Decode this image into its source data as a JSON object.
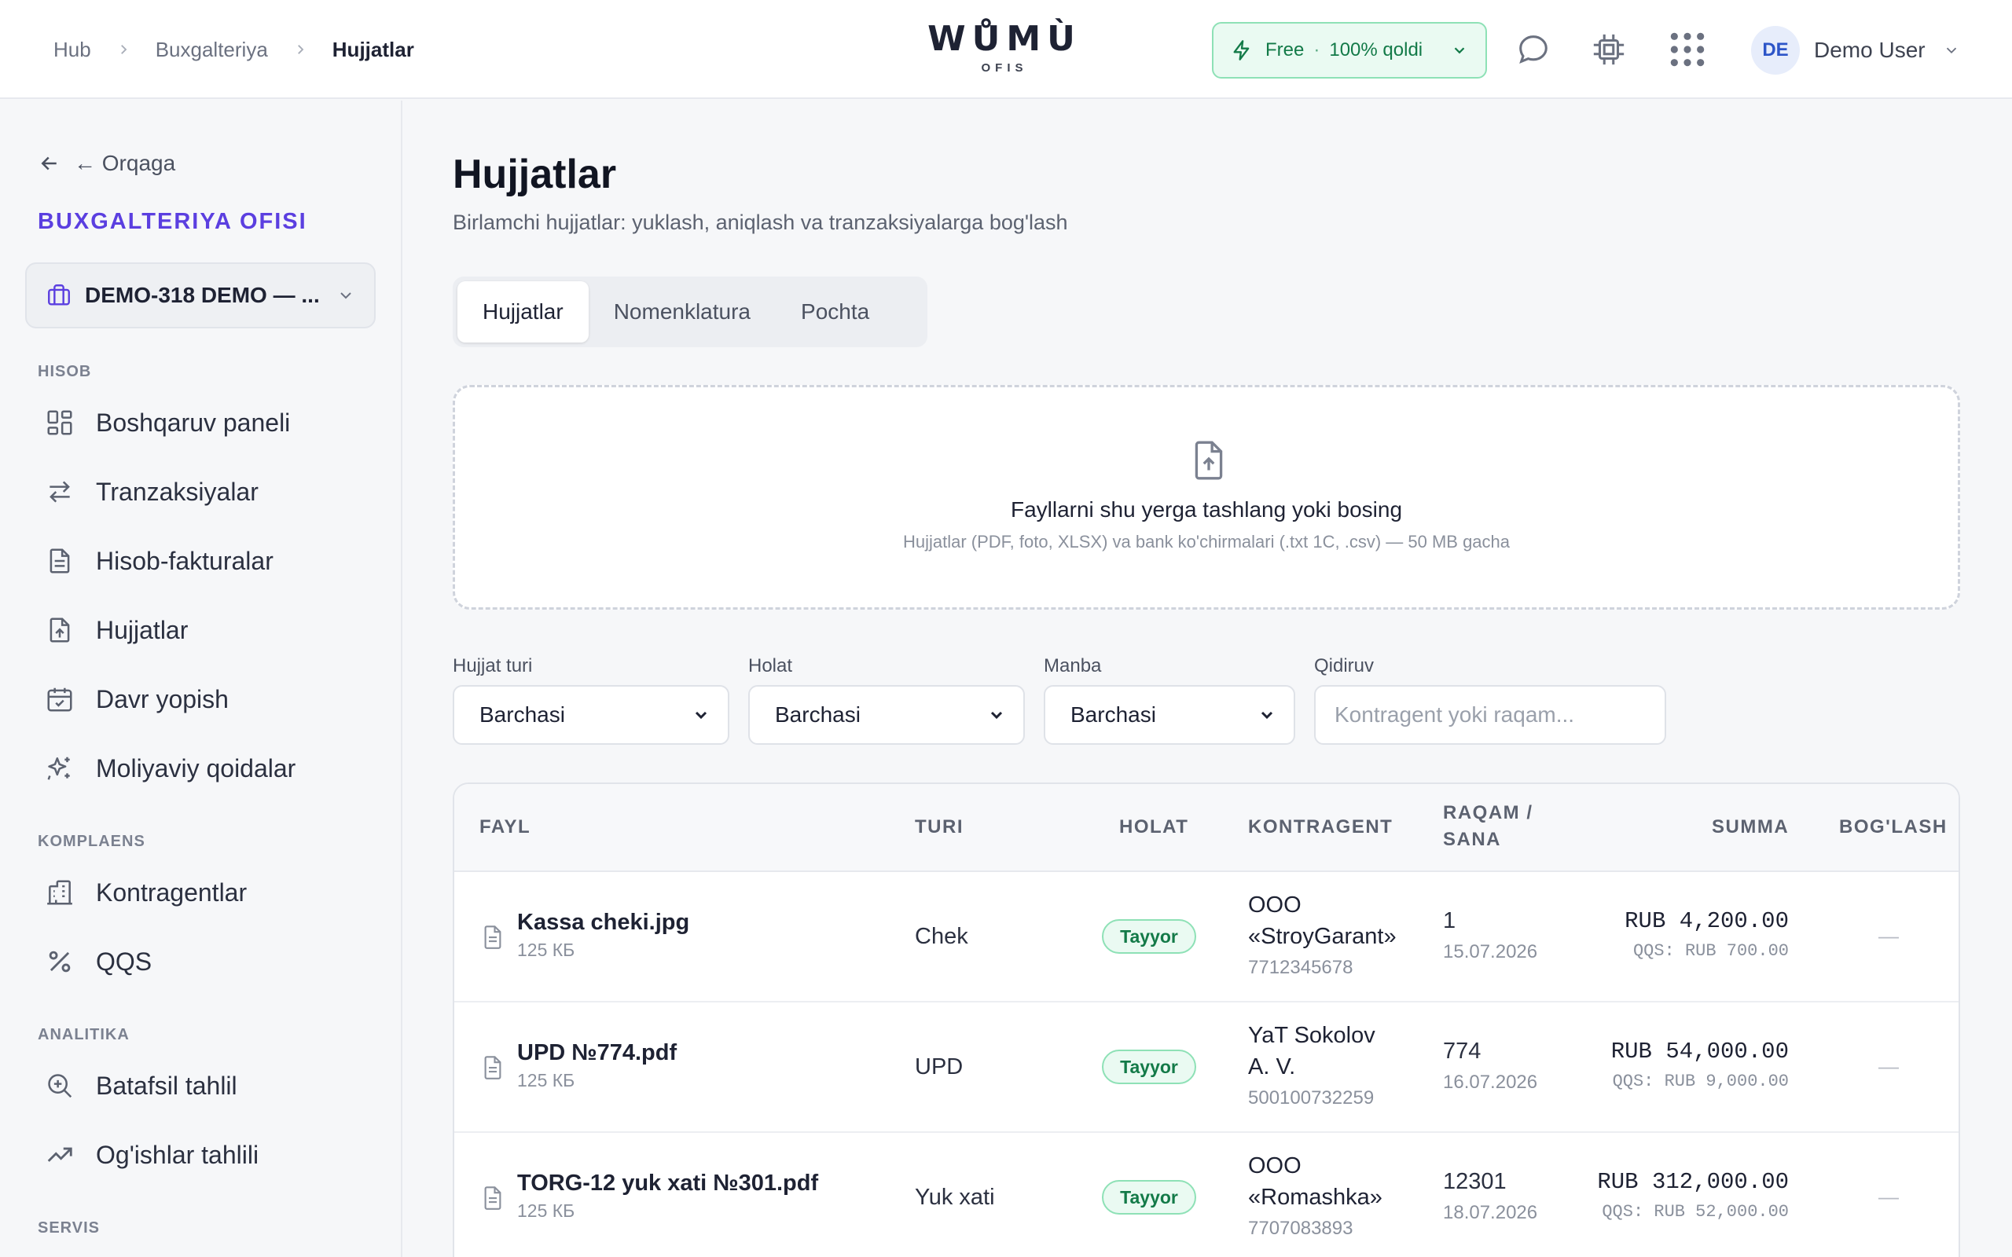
{
  "breadcrumb": [
    "Hub",
    "Buxgalteriya",
    "Hujjatlar"
  ],
  "logo": {
    "name": "WŮMÙ",
    "sub": "OFIS"
  },
  "plan": {
    "name": "Free",
    "status": "100% qoldi"
  },
  "user": {
    "initials": "DE",
    "name": "Demo User"
  },
  "sidebar": {
    "back_label": "← Orqaga",
    "office_title": "BUXGALTERIYA OFISI",
    "org_label": "DEMO-318 DEMO — ...",
    "sections": {
      "hisob": "HISOB",
      "komplaens": "KOMPLAENS",
      "analitika": "ANALITIKA",
      "servis": "SERVIS"
    },
    "items": {
      "dashboard": "Boshqaruv paneli",
      "transactions": "Tranzaksiyalar",
      "invoices": "Hisob-fakturalar",
      "documents": "Hujjatlar",
      "period_close": "Davr yopish",
      "rules": "Moliyaviy qoidalar",
      "counterparties": "Kontragentlar",
      "vat": "QQS",
      "detailed": "Batafsil tahlil",
      "deviations": "Og'ishlar tahlili"
    }
  },
  "page": {
    "title": "Hujjatlar",
    "subtitle": "Birlamchi hujjatlar: yuklash, aniqlash va tranzaksiyalarga bog'lash",
    "tabs": [
      "Hujjatlar",
      "Nomenklatura",
      "Pochta"
    ],
    "active_tab": "Hujjatlar"
  },
  "dropzone": {
    "title": "Fayllarni shu yerga tashlang yoki bosing",
    "hint": "Hujjatlar (PDF, foto, XLSX) va bank ko'chirmalari (.txt 1C, .csv) — 50 MB gacha"
  },
  "filters": {
    "type": {
      "label": "Hujjat turi",
      "value": "Barchasi"
    },
    "status": {
      "label": "Holat",
      "value": "Barchasi"
    },
    "source": {
      "label": "Manba",
      "value": "Barchasi"
    },
    "search": {
      "label": "Qidiruv",
      "placeholder": "Kontragent yoki raqam..."
    }
  },
  "table": {
    "headers": {
      "file": "FAYL",
      "type": "TURI",
      "status": "HOLAT",
      "counterparty": "KONTRAGENT",
      "number_date_1": "RAQAM /",
      "number_date_2": "SANA",
      "sum": "SUMMA",
      "link": "BOG'LASH"
    },
    "rows": [
      {
        "file": "Kassa cheki.jpg",
        "size": "125 КБ",
        "type": "Chek",
        "status": "Tayyor",
        "cp_line1": "OOO",
        "cp_line2": "«StroyGarant»",
        "inn": "7712345678",
        "number": "1",
        "date": "15.07.2026",
        "sum": "RUB 4,200.00",
        "vat": "QQS: RUB 700.00",
        "link": "—"
      },
      {
        "file": "UPD №774.pdf",
        "size": "125 КБ",
        "type": "UPD",
        "status": "Tayyor",
        "cp_line1": "YaT Sokolov",
        "cp_line2": "A. V.",
        "inn": "500100732259",
        "number": "774",
        "date": "16.07.2026",
        "sum": "RUB 54,000.00",
        "vat": "QQS: RUB 9,000.00",
        "link": "—"
      },
      {
        "file": "TORG-12 yuk xati №301.pdf",
        "size": "125 КБ",
        "type": "Yuk xati",
        "status": "Tayyor",
        "cp_line1": "OOO",
        "cp_line2": "«Romashka»",
        "inn": "7707083893",
        "number": "12301",
        "date": "18.07.2026",
        "sum": "RUB 312,000.00",
        "vat": "QQS: RUB 52,000.00",
        "link": "—"
      }
    ]
  },
  "colors": {
    "accent": "#5b3fe0",
    "success": "#137a48",
    "success_bg": "#eafaf2"
  }
}
